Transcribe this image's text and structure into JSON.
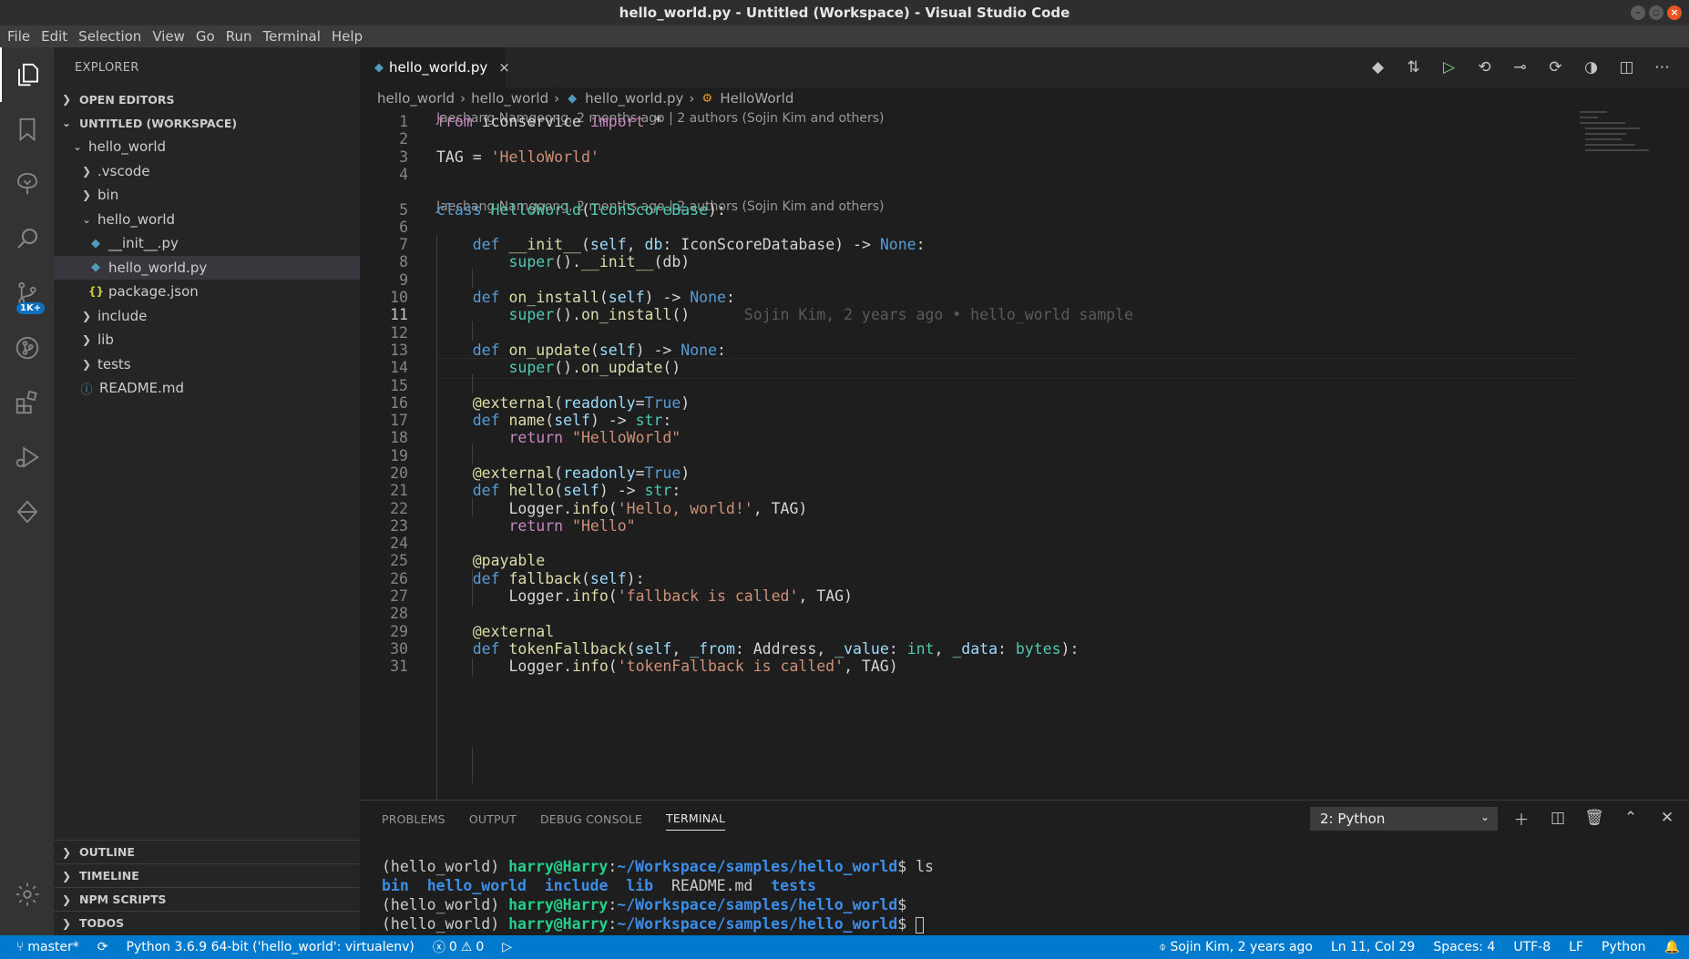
{
  "window": {
    "title": "hello_world.py - Untitled (Workspace) - Visual Studio Code"
  },
  "menu": [
    "File",
    "Edit",
    "Selection",
    "View",
    "Go",
    "Run",
    "Terminal",
    "Help"
  ],
  "activity_bar": {
    "items": [
      "explorer-icon",
      "bookmarks-icon",
      "source-control-tree-icon",
      "search-icon",
      "source-control-icon",
      "git-graph-icon",
      "extensions-icon",
      "run-debug-icon",
      "deploy-icon"
    ],
    "scm_badge": "1K+",
    "manage": "gear-icon"
  },
  "sidebar": {
    "title": "EXPLORER",
    "open_editors": "OPEN EDITORS",
    "workspace": "UNTITLED (WORKSPACE)",
    "tree": [
      {
        "label": "hello_world",
        "depth": 0,
        "type": "folder-open"
      },
      {
        "label": ".vscode",
        "depth": 1,
        "type": "folder"
      },
      {
        "label": "bin",
        "depth": 1,
        "type": "folder"
      },
      {
        "label": "hello_world",
        "depth": 1,
        "type": "folder-open"
      },
      {
        "label": "__init__.py",
        "depth": 2,
        "type": "python"
      },
      {
        "label": "hello_world.py",
        "depth": 2,
        "type": "python",
        "selected": true
      },
      {
        "label": "package.json",
        "depth": 2,
        "type": "json"
      },
      {
        "label": "include",
        "depth": 1,
        "type": "folder"
      },
      {
        "label": "lib",
        "depth": 1,
        "type": "folder"
      },
      {
        "label": "tests",
        "depth": 1,
        "type": "folder"
      },
      {
        "label": "README.md",
        "depth": 1,
        "type": "info"
      }
    ],
    "bottom_sections": [
      "OUTLINE",
      "TIMELINE",
      "NPM SCRIPTS",
      "TODOS"
    ]
  },
  "editor": {
    "tab": {
      "label": "hello_world.py",
      "close": "×"
    },
    "breadcrumb": [
      "hello_world",
      "hello_world",
      "hello_world.py",
      "HelloWorld"
    ],
    "codelens_1": "Jaechang Namgoong, 2 months ago | 2 authors (Sojin Kim and others)",
    "codelens_2": "Jaechang Namgoong, 2 months ago | 2 authors (Sojin Kim and others)",
    "blame_line_11": "Sojin Kim, 2 years ago • hello_world sample",
    "line_numbers": [
      "1",
      "2",
      "3",
      "4",
      "5",
      "6",
      "7",
      "8",
      "9",
      "10",
      "11",
      "12",
      "13",
      "14",
      "15",
      "16",
      "17",
      "18",
      "19",
      "20",
      "21",
      "22",
      "23",
      "24",
      "25",
      "26",
      "27",
      "28",
      "29",
      "30",
      "31"
    ],
    "current_line": 11
  },
  "panel": {
    "tabs": [
      "PROBLEMS",
      "OUTPUT",
      "DEBUG CONSOLE",
      "TERMINAL"
    ],
    "active_tab": "TERMINAL",
    "terminal_select": "2: Python",
    "terminal": {
      "env": "(hello_world)",
      "user": "harry@Harry",
      "path": "~/Workspace/samples/hello_world",
      "cmd1": "ls",
      "ls_dirs": [
        "bin",
        "hello_world",
        "include",
        "lib"
      ],
      "ls_file": "README.md",
      "ls_last": "tests"
    }
  },
  "statusbar": {
    "branch": "master*",
    "interpreter": "Python 3.6.9 64-bit ('hello_world': virtualenv)",
    "errors": "0",
    "warnings": "0",
    "blame": "Sojin Kim, 2 years ago",
    "position": "Ln 11, Col 29",
    "spaces": "Spaces: 4",
    "encoding": "UTF-8",
    "eol": "LF",
    "language": "Python"
  },
  "colors": {
    "statusbar": "#007acc",
    "activity_bar": "#333333",
    "sidebar": "#252526",
    "editor": "#1e1e1e"
  }
}
